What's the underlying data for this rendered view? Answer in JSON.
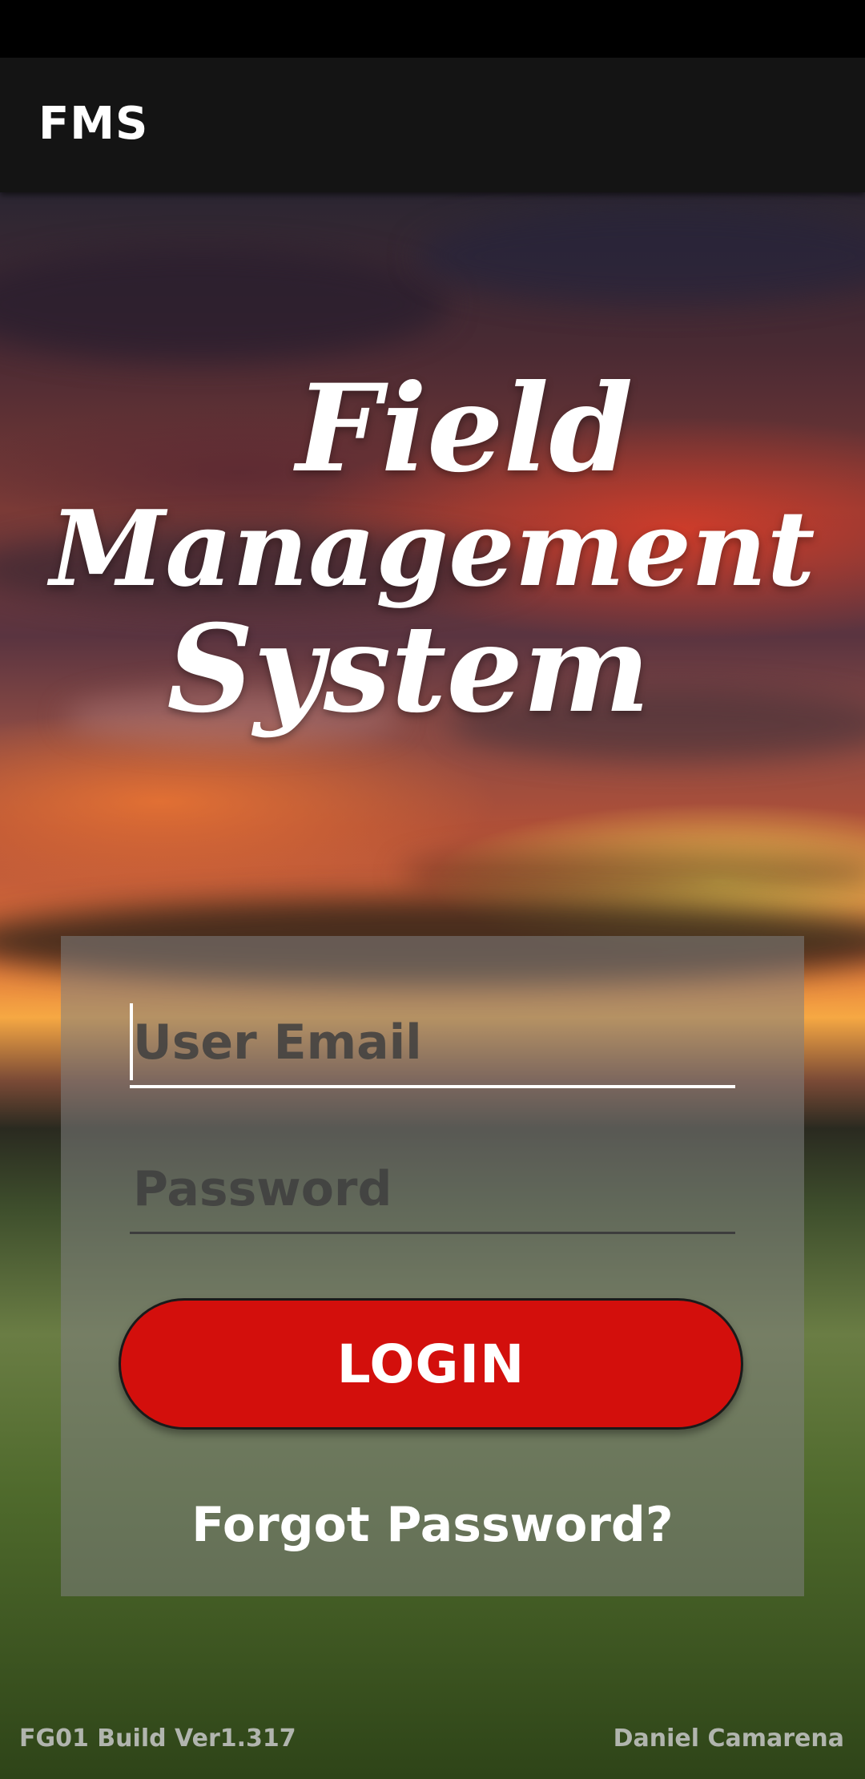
{
  "app_bar": {
    "title": "FMS"
  },
  "logo": {
    "line1": "Field",
    "line2": "Management",
    "line3": "System"
  },
  "login_form": {
    "email_placeholder": "User Email",
    "email_value": "",
    "password_placeholder": "Password",
    "password_value": "",
    "login_label": "LOGIN",
    "forgot_label": "Forgot Password?"
  },
  "footer": {
    "build": "FG01 Build Ver1.317",
    "author": "Daniel Camarena"
  },
  "colors": {
    "app_bar_bg": "#141414",
    "login_button": "#d30f0c",
    "card_overlay": "rgba(128,128,128,0.55)"
  }
}
